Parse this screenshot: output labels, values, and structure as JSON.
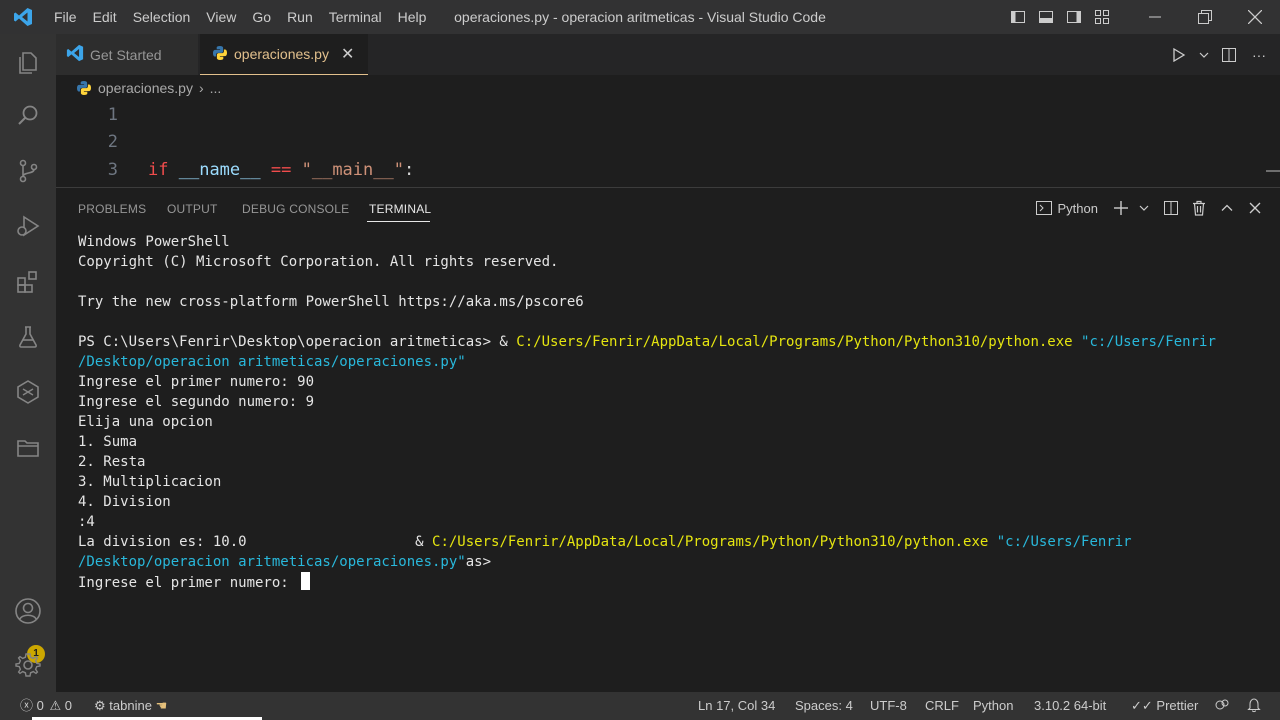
{
  "window": {
    "title": "operaciones.py - operacion aritmeticas - Visual Studio Code",
    "menu": [
      "File",
      "Edit",
      "Selection",
      "View",
      "Go",
      "Run",
      "Terminal",
      "Help"
    ]
  },
  "tabs": [
    {
      "label": "Get Started",
      "icon": "vscode-icon"
    },
    {
      "label": "operaciones.py",
      "icon": "python-icon",
      "active": true
    }
  ],
  "breadcrumb": {
    "file": "operaciones.py",
    "more": "..."
  },
  "editor": {
    "lines": [
      {
        "number": "1",
        "code": ""
      },
      {
        "number": "2",
        "code": ""
      },
      {
        "number": "3",
        "code": "if __name__ == \"__main__\":"
      }
    ]
  },
  "panel": {
    "tabs": [
      "PROBLEMS",
      "OUTPUT",
      "DEBUG CONSOLE",
      "TERMINAL"
    ],
    "active_tab": "TERMINAL",
    "shell_label": "Python"
  },
  "terminal": {
    "lines": [
      [
        {
          "t": "Windows PowerShell"
        }
      ],
      [
        {
          "t": "Copyright (C) Microsoft Corporation. All rights reserved."
        }
      ],
      [
        {
          "t": ""
        }
      ],
      [
        {
          "t": "Try the new cross-platform PowerShell https://aka.ms/pscore6"
        }
      ],
      [
        {
          "t": ""
        }
      ],
      [
        {
          "t": "PS C:\\Users\\Fenrir\\Desktop\\operacion aritmeticas> & "
        },
        {
          "t": "C:/Users/Fenrir/AppData/Local/Programs/Python/Python310/python.exe",
          "c": "yellow"
        },
        {
          "t": " \"c:/Users/Fenrir",
          "c": "cyan"
        }
      ],
      [
        {
          "t": "/Desktop/operacion aritmeticas/operaciones.py\"",
          "c": "cyan"
        }
      ],
      [
        {
          "t": "Ingrese el primer numero: 90"
        }
      ],
      [
        {
          "t": "Ingrese el segundo numero: 9"
        }
      ],
      [
        {
          "t": "Elija una opcion"
        }
      ],
      [
        {
          "t": "1. Suma"
        }
      ],
      [
        {
          "t": "2. Resta"
        }
      ],
      [
        {
          "t": "3. Multiplicacion"
        }
      ],
      [
        {
          "t": "4. Division"
        }
      ],
      [
        {
          "t": ":4"
        }
      ],
      [
        {
          "t": "La division es: 10.0                    & "
        },
        {
          "t": "C:/Users/Fenrir/AppData/Local/Programs/Python/Python310/python.exe",
          "c": "yellow"
        },
        {
          "t": " \"c:/Users/Fenrir",
          "c": "cyan"
        }
      ],
      [
        {
          "t": "/Desktop/operacion aritmeticas/operaciones.py\"",
          "c": "cyan"
        },
        {
          "t": "as>"
        }
      ],
      [
        {
          "t": "Ingrese el primer numero: "
        },
        {
          "cursor": true
        }
      ]
    ]
  },
  "activity": {
    "accounts_badge": "1"
  },
  "statusbar": {
    "errors": "0",
    "warnings": "0",
    "tabnine": "tabnine",
    "position": "Ln 17, Col 34",
    "spaces": "Spaces: 4",
    "encoding": "UTF-8",
    "eol": "CRLF",
    "language": "Python",
    "interpreter": "3.10.2 64-bit",
    "prettier": "Prettier"
  },
  "colors": {
    "accent_tab": "#e2c08d",
    "terminal_yellow": "#e5e510",
    "terminal_cyan": "#29b8db",
    "badge": "#cca700"
  }
}
